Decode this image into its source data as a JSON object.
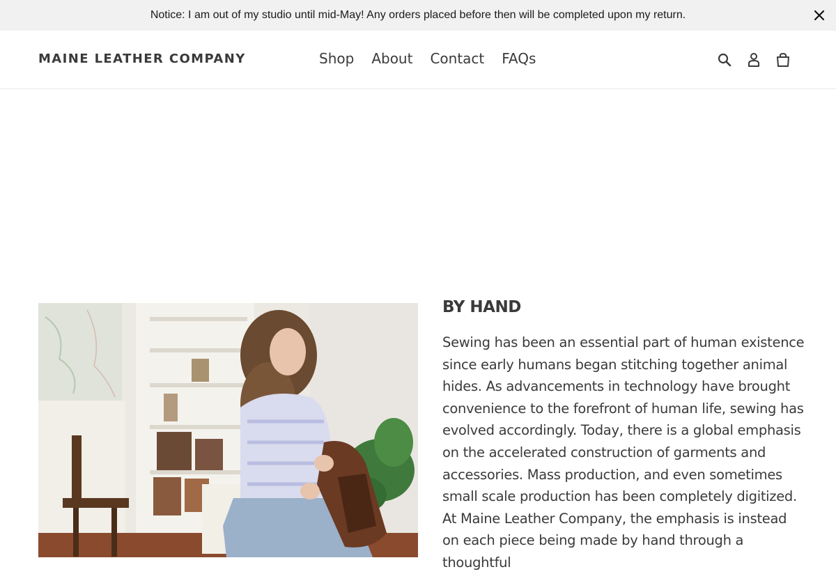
{
  "announcement": {
    "text": "Notice: I am out of my studio until mid-May! Any orders placed before then will be completed upon my return.",
    "close_icon": "close-icon"
  },
  "header": {
    "logo": "MAINE LEATHER COMPANY",
    "nav": [
      {
        "label": "Shop"
      },
      {
        "label": "About"
      },
      {
        "label": "Contact"
      },
      {
        "label": "FAQs"
      }
    ],
    "icons": [
      "search-icon",
      "account-icon",
      "cart-icon"
    ]
  },
  "feature": {
    "image": "woman-stitching-leather-bag-in-studio",
    "heading": "BY HAND",
    "body": "Sewing has been an essential part of human existence since early humans began stitching together animal hides. As advancements in technology have brought convenience to the forefront of human life, sewing has evolved accordingly. Today, there is a global emphasis on the accelerated construction of garments and accessories. Mass production, and even sometimes small scale production has been completely digitized.  At Maine Leather Company, the emphasis is instead on each piece being made by hand through a thoughtful"
  },
  "colors": {
    "text": "#3a3a3a",
    "announcement_bg": "#f1f1f1",
    "background": "#ffffff"
  }
}
